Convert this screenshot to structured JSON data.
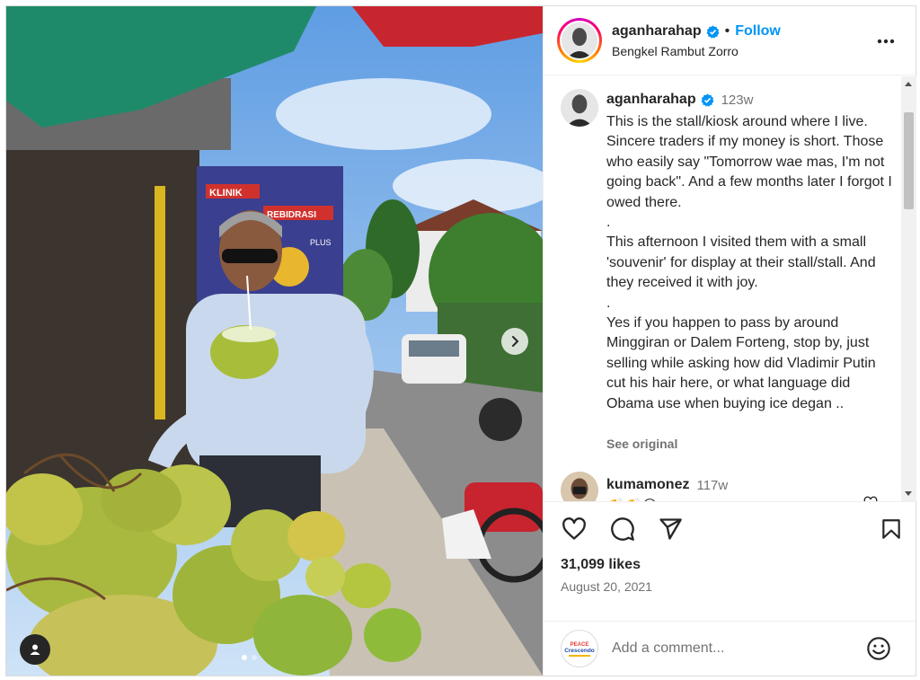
{
  "header": {
    "username": "aganharahap",
    "separator": "•",
    "follow_label": "Follow",
    "location": "Bengkel Rambut Zorro",
    "more_icon": "more-horizontal-icon"
  },
  "caption": {
    "username": "aganharahap",
    "time": "123w",
    "text": "This is the stall/kiosk around where I live. Sincere traders if my money is short. Those who easily say \"Tomorrow wae mas, I'm not going back\". And a few months later I forgot I owed there.\n.\nThis afternoon I visited them with a small 'souvenir' for display at their stall/stall. And they received it with joy.\n.\nYes if you happen to pass by around Minggiran or Dalem Forteng, stop by, just selling while asking how did Vladimir Putin cut his hair here, or what language did Obama use when buying ice degan ..",
    "see_original": "See original"
  },
  "comment": {
    "username": "kumamonez",
    "time": "117w",
    "text": "👏👏😍"
  },
  "photo_sign": {
    "line1": "KLINIK",
    "line2": "REBIDRASI",
    "line3": "PLUS"
  },
  "actions": {
    "likes": "31,099 likes",
    "date": "August 20, 2021"
  },
  "add_comment": {
    "placeholder": "Add a comment...",
    "avatar_line1": "PEACE",
    "avatar_line2": "Crescendo"
  },
  "carousel": {
    "total": 2,
    "current": 1
  },
  "colors": {
    "accent": "#0095f6",
    "text": "#262626",
    "muted": "#737373"
  }
}
